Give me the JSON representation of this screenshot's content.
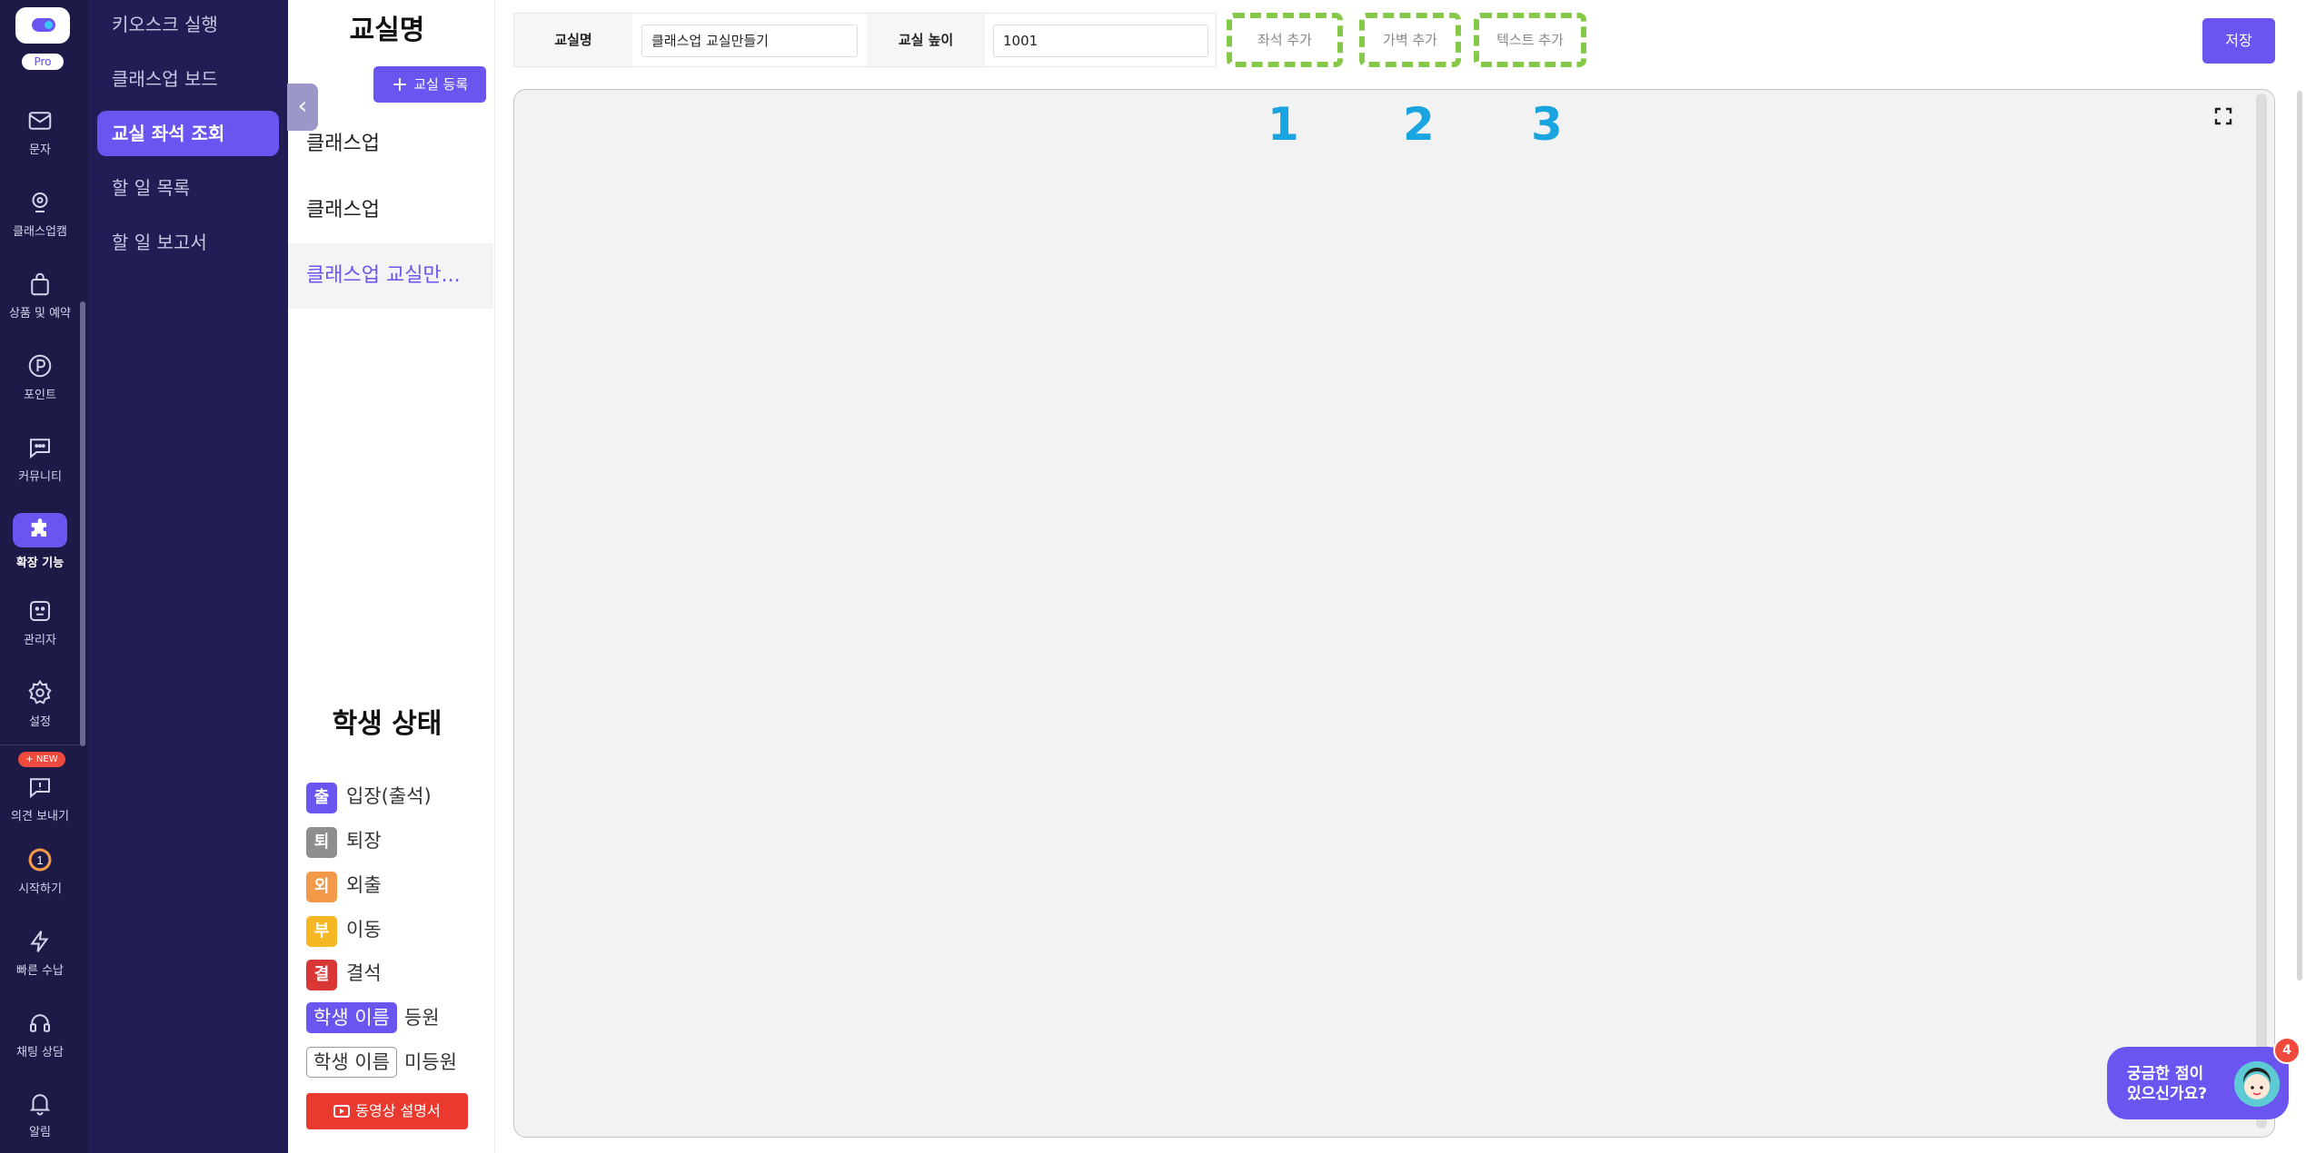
{
  "rail": {
    "plan_badge": "Pro",
    "new_badge": "+ NEW",
    "items": [
      {
        "label": "문자",
        "icon": "mail-icon"
      },
      {
        "label": "클래스업캠",
        "icon": "webcam-icon"
      },
      {
        "label": "상품 및 예약",
        "icon": "shopping-bag-icon"
      },
      {
        "label": "포인트",
        "icon": "point-coin-icon"
      },
      {
        "label": "커뮤니티",
        "icon": "chat-bubble-icon"
      },
      {
        "label": "확장 기능",
        "icon": "puzzle-icon"
      },
      {
        "label": "관리자",
        "icon": "admin-icon"
      },
      {
        "label": "설정",
        "icon": "gear-icon"
      },
      {
        "label": "의견 보내기",
        "icon": "feedback-icon"
      },
      {
        "label": "시작하기",
        "icon": "start-badge-icon"
      },
      {
        "label": "빠른 수납",
        "icon": "lightning-icon"
      },
      {
        "label": "채팅 상담",
        "icon": "headset-icon"
      },
      {
        "label": "알림",
        "icon": "bell-icon"
      }
    ],
    "start_badge_number": "1"
  },
  "menu": {
    "items": [
      "키오스크 실행",
      "클래스업 보드",
      "교실 좌석 조회",
      "할 일 목록",
      "할 일 보고서"
    ]
  },
  "panel": {
    "title": "교실명",
    "add_button": "교실 등록",
    "rooms": [
      "클래스업",
      "클래스업",
      "클래스업 교실만..."
    ],
    "status_title": "학생 상태",
    "statuses": [
      {
        "badge": "출",
        "label": "입장(출석)",
        "color": "#6a55f0"
      },
      {
        "badge": "퇴",
        "label": "퇴장",
        "color": "#8e8e8e"
      },
      {
        "badge": "외",
        "label": "외출",
        "color": "#f2994a"
      },
      {
        "badge": "부",
        "label": "이동",
        "color": "#f5b824"
      },
      {
        "badge": "결",
        "label": "결석",
        "color": "#d93636"
      }
    ],
    "enrolled": {
      "name": "학생 이름",
      "label": "등원"
    },
    "not_enrolled": {
      "name": "학생 이름",
      "label": "미등원"
    },
    "video_button": "동영상 설명서"
  },
  "form": {
    "room_name_label": "교실명",
    "room_name_value": "클래스업 교실만들기",
    "height_label": "교실 높이",
    "height_value": "1001"
  },
  "tools": {
    "add_seat": "좌석 추가",
    "add_wall": "가벽 추가",
    "add_text": "텍스트 추가"
  },
  "annotations": [
    "1",
    "2",
    "3"
  ],
  "save_button": "저장",
  "help": {
    "line1": "궁금한 점이",
    "line2": "있으신가요?",
    "count": "4"
  },
  "colors": {
    "accent": "#6a55f0",
    "dark_nav": "#1e1a48",
    "annotation_outline": "#86c94a",
    "annotation_number": "#1aa5e0"
  }
}
